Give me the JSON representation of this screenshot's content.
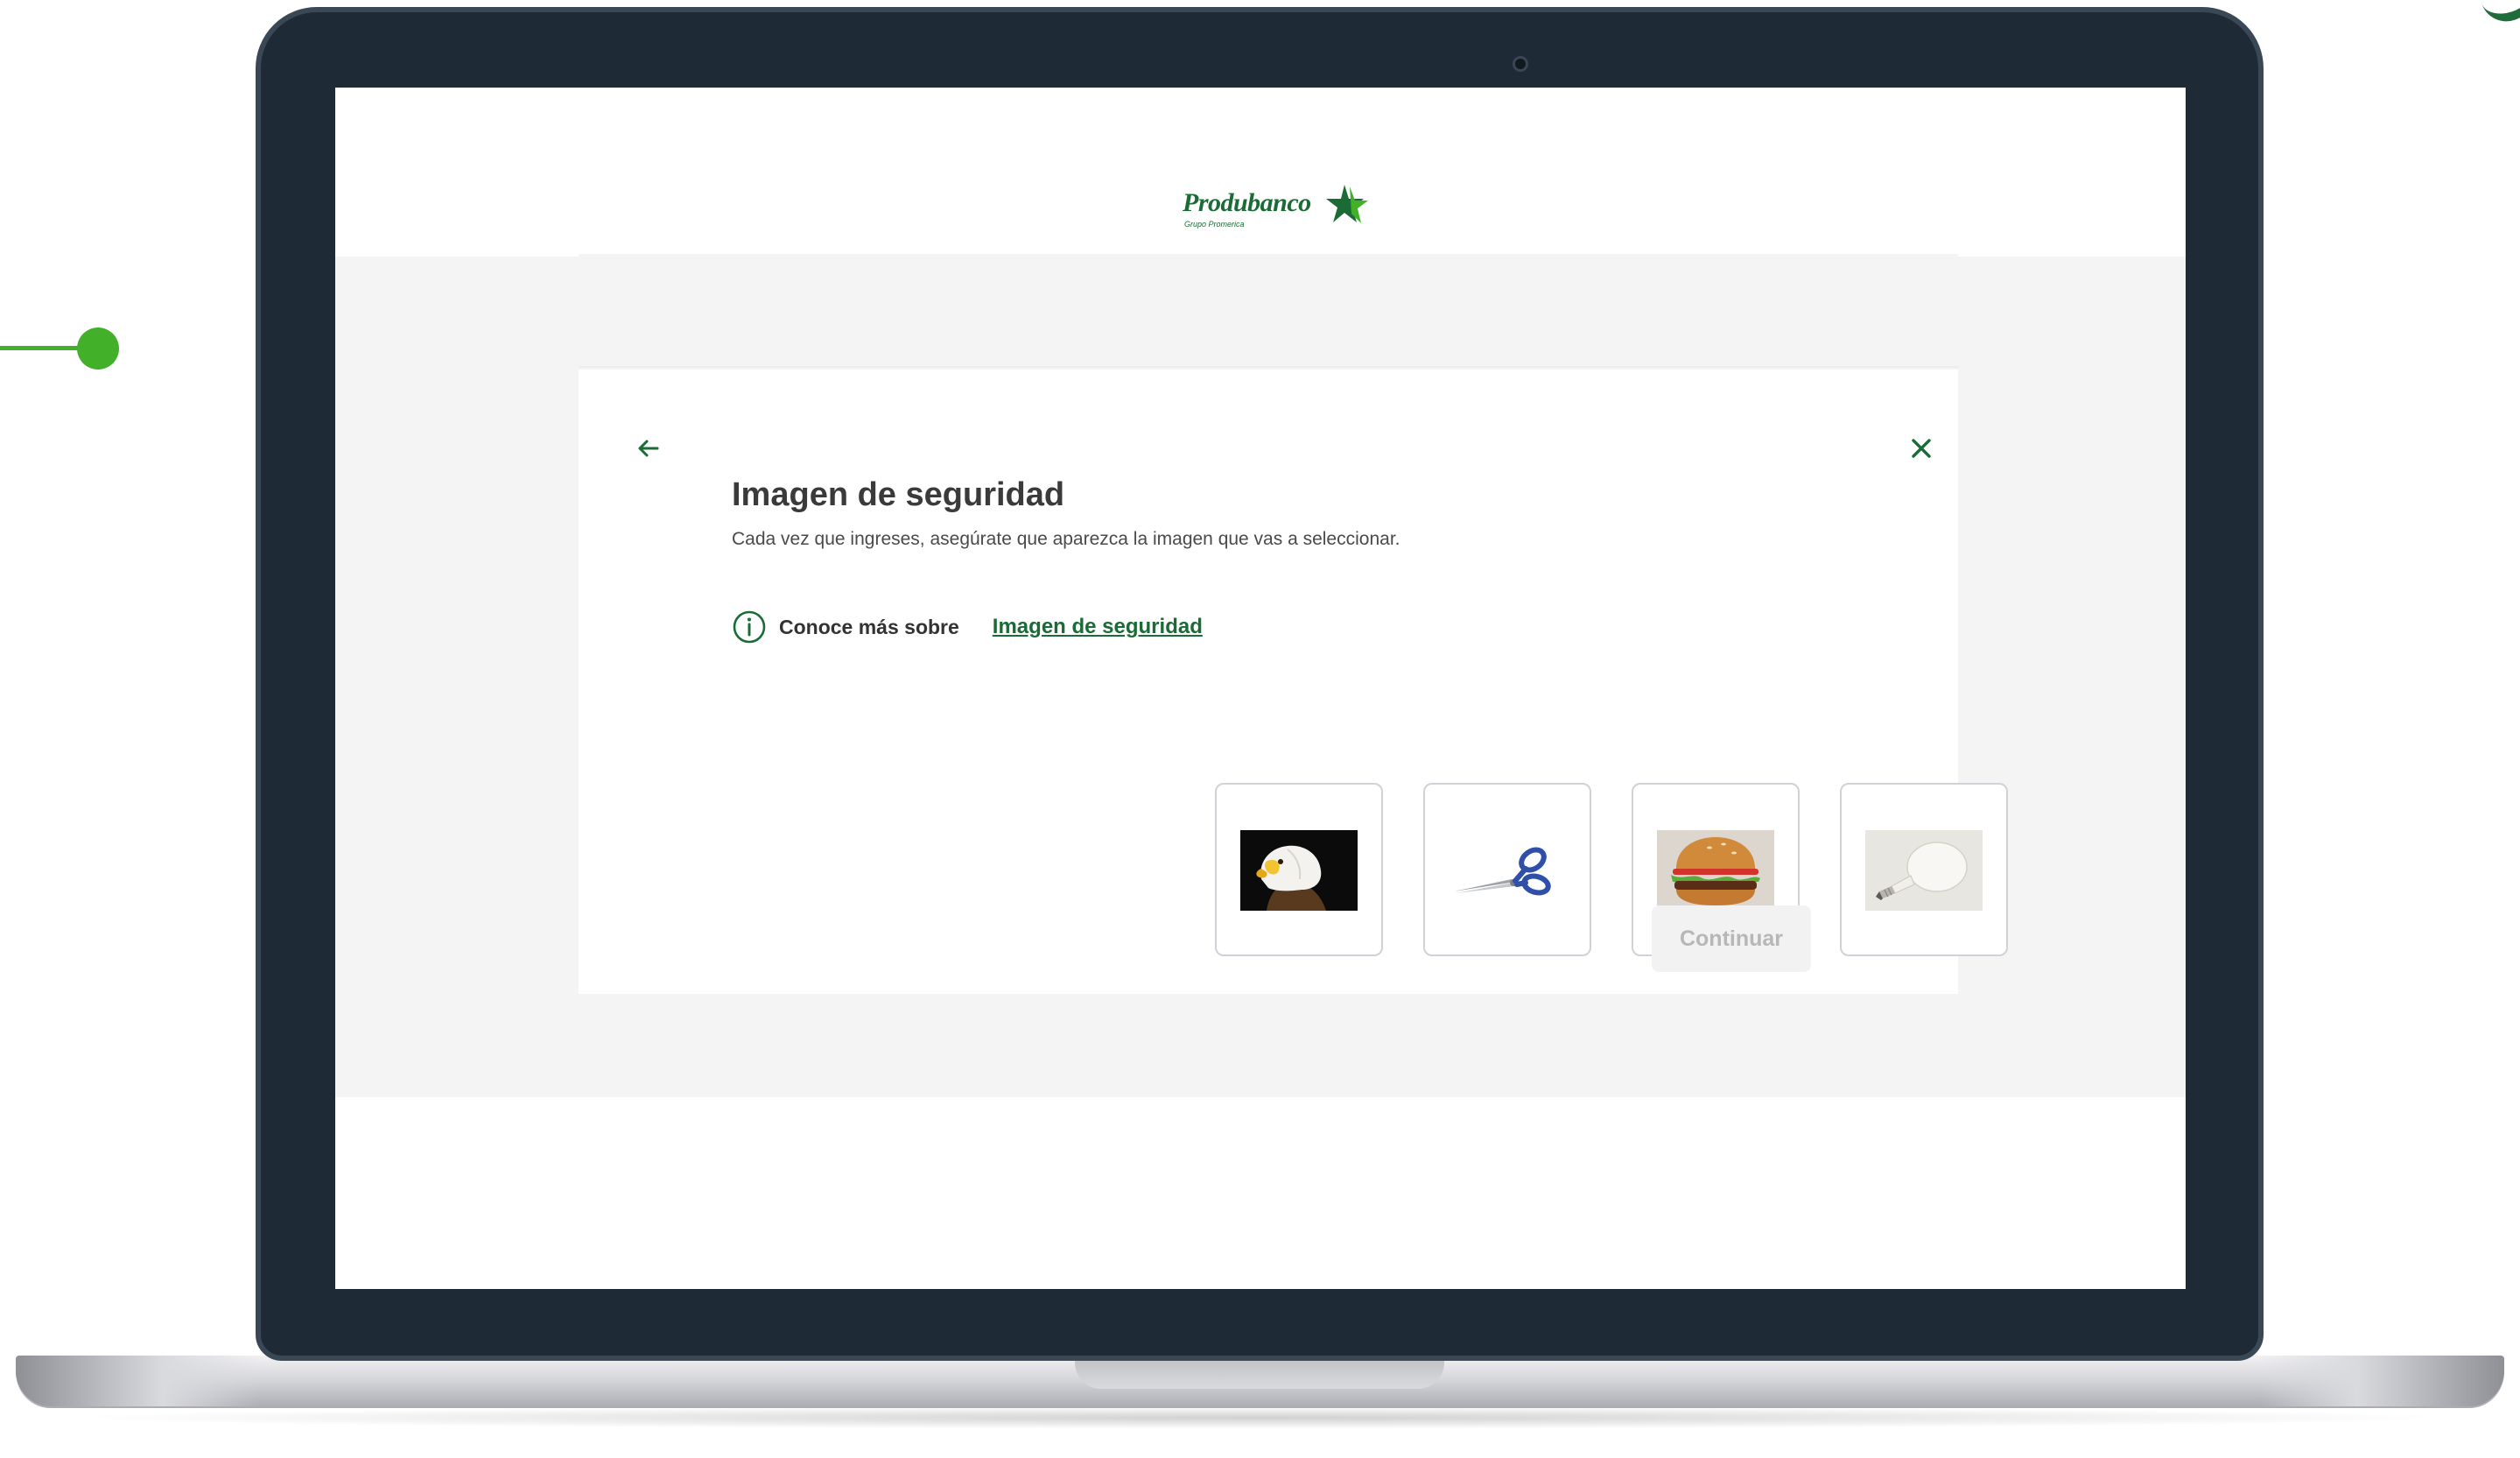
{
  "brand": {
    "name": "Produbanco",
    "subtitle": "Grupo Promerica",
    "color_primary": "#1a6b35",
    "color_accent": "#43b02a"
  },
  "card": {
    "back_icon": "arrow-left-icon",
    "close_icon": "close-icon",
    "title": "Imagen de seguridad",
    "subtitle": "Cada vez que ingreses, asegúrate que aparezca la imagen que vas a seleccionar.",
    "info": {
      "icon": "info-circle-icon",
      "label": "Conoce más sobre",
      "link_text": "Imagen de seguridad"
    },
    "options": [
      {
        "icon": "eagle-image"
      },
      {
        "icon": "scissors-image"
      },
      {
        "icon": "hamburger-image"
      },
      {
        "icon": "lightbulb-image"
      }
    ],
    "continue_label": "Continuar"
  }
}
